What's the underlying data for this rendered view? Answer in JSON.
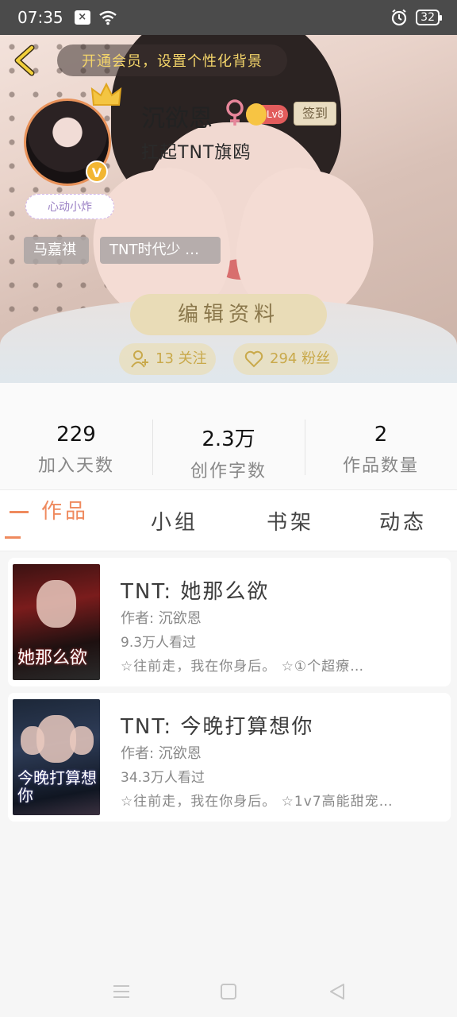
{
  "status_bar": {
    "time": "07:35",
    "battery": "32"
  },
  "header": {
    "vip_banner": "开通会员，设置个性化背景"
  },
  "profile": {
    "name": "沉欲恩",
    "level": "Lv8",
    "sign_label": "签到",
    "bio": "扛起TNT旗鸥",
    "heart_tag": "心动小炸",
    "tags": [
      "马嘉祺",
      "TNT时代少 …"
    ],
    "edit_label": "编辑资料",
    "follow": "13 关注",
    "fans": "294 粉丝"
  },
  "stats": [
    {
      "value": "229",
      "label": "加入天数"
    },
    {
      "value": "2.3万",
      "label": "创作字数"
    },
    {
      "value": "2",
      "label": "作品数量"
    }
  ],
  "tabs": [
    {
      "label": "作品",
      "active": true
    },
    {
      "label": "小组"
    },
    {
      "label": "书架"
    },
    {
      "label": "动态"
    }
  ],
  "works": [
    {
      "cover_title": "她那么欲",
      "title": "TNT:  她那么欲",
      "author": "作者: 沉欲恩",
      "reads": "9.3万人看过",
      "desc": "☆往前走，我在你身后。 ☆①个超療…"
    },
    {
      "cover_title": "今晚打算想你",
      "title": "TNT:  今晚打算想你",
      "author": "作者: 沉欲恩",
      "reads": "34.3万人看过",
      "desc": "☆往前走，我在你身后。 ☆1v7高能甜宠…"
    }
  ],
  "colors": {
    "accent": "#ef8a5e",
    "gold": "#c9a94b",
    "status_bg": "#4b4b4b"
  }
}
